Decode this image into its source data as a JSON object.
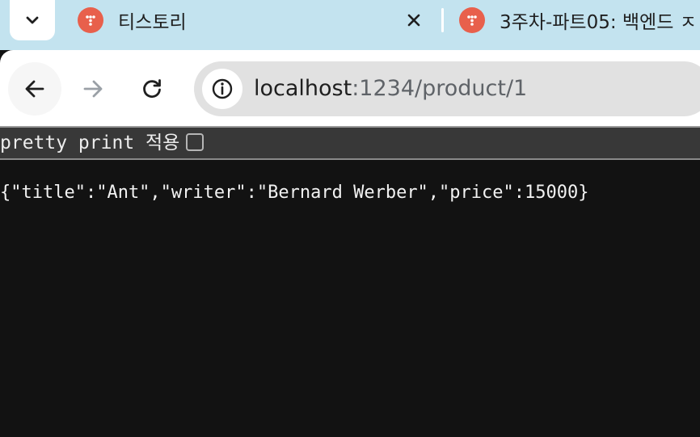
{
  "browser": {
    "tabs": [
      {
        "title": "티스토리",
        "favicon": "tistory-favicon"
      },
      {
        "title": "3주차-파트05: 백엔드 ㅈ",
        "favicon": "tistory-favicon"
      }
    ],
    "address_bar": {
      "host": "localhost",
      "path": ":1234/product/1"
    },
    "icons": {
      "tab_search": "chevron-down-icon",
      "close": "close-icon",
      "back": "back-arrow-icon",
      "forward": "forward-arrow-icon",
      "reload": "reload-icon",
      "site_info": "info-icon"
    }
  },
  "page": {
    "pretty_print_label": "pretty print 적용",
    "pretty_print_checked": false,
    "json_text": "{\"title\":\"Ant\",\"writer\":\"Bernard Werber\",\"price\":15000}"
  },
  "colors": {
    "tabstrip_bg": "#c3e3ef",
    "favicon": "#e8604c",
    "page_bg": "#121212",
    "pretty_print_bar": "#383838"
  }
}
